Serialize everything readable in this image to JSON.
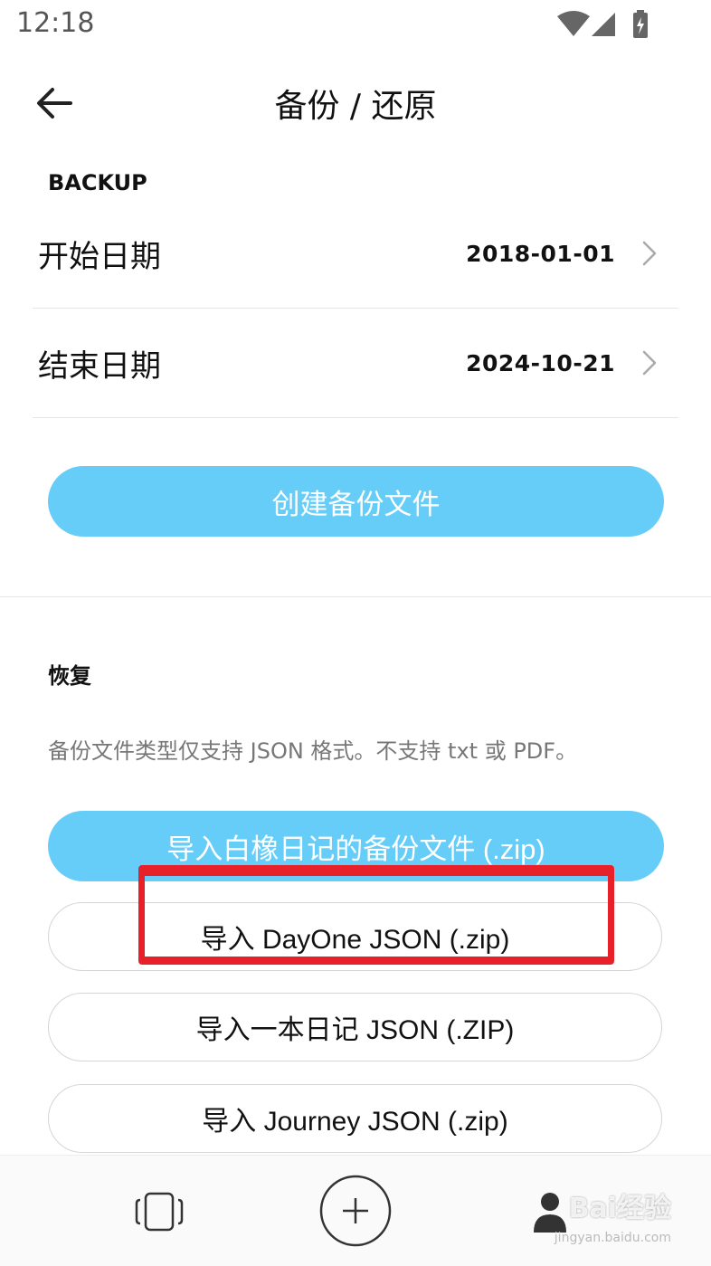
{
  "status_bar": {
    "time": "12:18"
  },
  "header": {
    "title": "备份 / 还原"
  },
  "backup": {
    "section_title": "BACKUP",
    "start_date_label": "开始日期",
    "start_date_value": "2018-01-01",
    "end_date_label": "结束日期",
    "end_date_value": "2024-10-21",
    "create_button": "创建备份文件"
  },
  "restore": {
    "section_title": "恢复",
    "description": "备份文件类型仅支持 JSON 格式。不支持 txt 或 PDF。",
    "buttons": [
      "导入白橡日记的备份文件 (.zip)",
      "导入 DayOne JSON (.zip)",
      "导入一本日记 JSON (.ZIP)",
      "导入 Journey JSON (.zip)"
    ]
  },
  "watermark": {
    "brand": "Bai经验",
    "url": "jingyan.baidu.com"
  },
  "colors": {
    "accent": "#66cdf9",
    "highlight": "#e8202a"
  }
}
